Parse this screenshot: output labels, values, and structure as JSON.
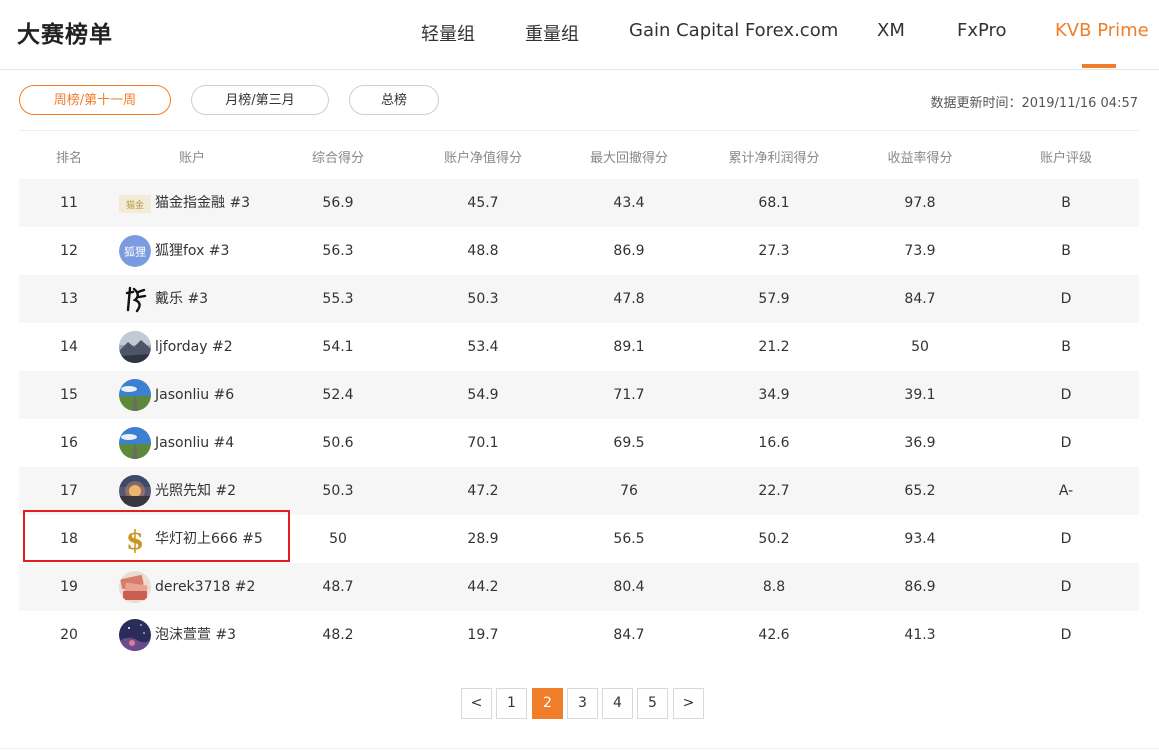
{
  "page_title": "大赛榜单",
  "nav_tabs": [
    {
      "label": "轻量组",
      "active": false
    },
    {
      "label": "重量组",
      "active": false
    },
    {
      "label": "Gain Capital Forex.com",
      "active": false
    },
    {
      "label": "XM",
      "active": false
    },
    {
      "label": "FxPro",
      "active": false
    },
    {
      "label": "KVB Prime",
      "active": true
    }
  ],
  "filters": [
    {
      "label": "周榜/第十一周",
      "active": true
    },
    {
      "label": "月榜/第三月",
      "active": false
    },
    {
      "label": "总榜",
      "active": false
    }
  ],
  "update_time": "数据更新时间：2019/11/16 04:57",
  "columns": [
    "排名",
    "账户",
    "综合得分",
    "账户净值得分",
    "最大回撤得分",
    "累计净利润得分",
    "收益率得分",
    "账户评级"
  ],
  "rows": [
    {
      "rank": "11",
      "account": "猫金指金融 #3",
      "avatar": "gold-logo-avatar",
      "total": "56.9",
      "equity": "45.7",
      "drawdown": "43.4",
      "profit": "68.1",
      "return": "97.8",
      "rating": "B"
    },
    {
      "rank": "12",
      "account": "狐狸fox #3",
      "avatar": "fox-text-avatar",
      "total": "56.3",
      "equity": "48.8",
      "drawdown": "86.9",
      "profit": "27.3",
      "return": "73.9",
      "rating": "B"
    },
    {
      "rank": "13",
      "account": "戴乐 #3",
      "avatar": "calligraphy-avatar",
      "total": "55.3",
      "equity": "50.3",
      "drawdown": "47.8",
      "profit": "57.9",
      "return": "84.7",
      "rating": "D"
    },
    {
      "rank": "14",
      "account": "ljforday #2",
      "avatar": "mountain-avatar",
      "total": "54.1",
      "equity": "53.4",
      "drawdown": "89.1",
      "profit": "21.2",
      "return": "50",
      "rating": "B"
    },
    {
      "rank": "15",
      "account": "Jasonliu #6",
      "avatar": "road-sky-avatar",
      "total": "52.4",
      "equity": "54.9",
      "drawdown": "71.7",
      "profit": "34.9",
      "return": "39.1",
      "rating": "D"
    },
    {
      "rank": "16",
      "account": "Jasonliu #4",
      "avatar": "road-sky-avatar",
      "total": "50.6",
      "equity": "70.1",
      "drawdown": "69.5",
      "profit": "16.6",
      "return": "36.9",
      "rating": "D"
    },
    {
      "rank": "17",
      "account": "光照先知 #2",
      "avatar": "sunset-avatar",
      "total": "50.3",
      "equity": "47.2",
      "drawdown": "76",
      "profit": "22.7",
      "return": "65.2",
      "rating": "A-"
    },
    {
      "rank": "18",
      "account": "华灯初上666 #5",
      "avatar": "dollar-sign-avatar",
      "total": "50",
      "equity": "28.9",
      "drawdown": "56.5",
      "profit": "50.2",
      "return": "93.4",
      "rating": "D"
    },
    {
      "rank": "19",
      "account": "derek3718 #2",
      "avatar": "cash-avatar",
      "total": "48.7",
      "equity": "44.2",
      "drawdown": "80.4",
      "profit": "8.8",
      "return": "86.9",
      "rating": "D"
    },
    {
      "rank": "20",
      "account": "泡沫萱萱 #3",
      "avatar": "night-sky-avatar",
      "total": "48.2",
      "equity": "19.7",
      "drawdown": "84.7",
      "profit": "42.6",
      "return": "41.3",
      "rating": "D"
    }
  ],
  "pagination": {
    "prev": "<",
    "next": ">",
    "pages": [
      "1",
      "2",
      "3",
      "4",
      "5"
    ],
    "current": "2"
  },
  "colors": {
    "accent": "#f07d2a",
    "highlight_border": "#e0201b",
    "row_shade": "#f6f6f6"
  }
}
